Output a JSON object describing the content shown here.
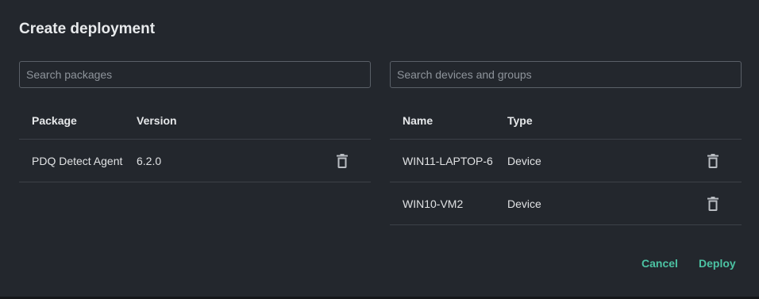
{
  "dialog": {
    "title": "Create deployment"
  },
  "packages": {
    "search_placeholder": "Search packages",
    "columns": [
      "Package",
      "Version"
    ],
    "rows": [
      {
        "name": "PDQ Detect Agent",
        "version": "6.2.0",
        "delete_icon": "trash-icon"
      }
    ]
  },
  "targets": {
    "search_placeholder": "Search devices and groups",
    "columns": [
      "Name",
      "Type"
    ],
    "rows": [
      {
        "name": "WIN11-LAPTOP-6",
        "type": "Device",
        "delete_icon": "trash-icon"
      },
      {
        "name": "WIN10-VM2",
        "type": "Device",
        "delete_icon": "trash-icon"
      }
    ]
  },
  "actions": {
    "cancel": "Cancel",
    "deploy": "Deploy"
  },
  "colors": {
    "background": "#23272d",
    "accent": "#4cc3a3",
    "divider": "#3c4148"
  }
}
